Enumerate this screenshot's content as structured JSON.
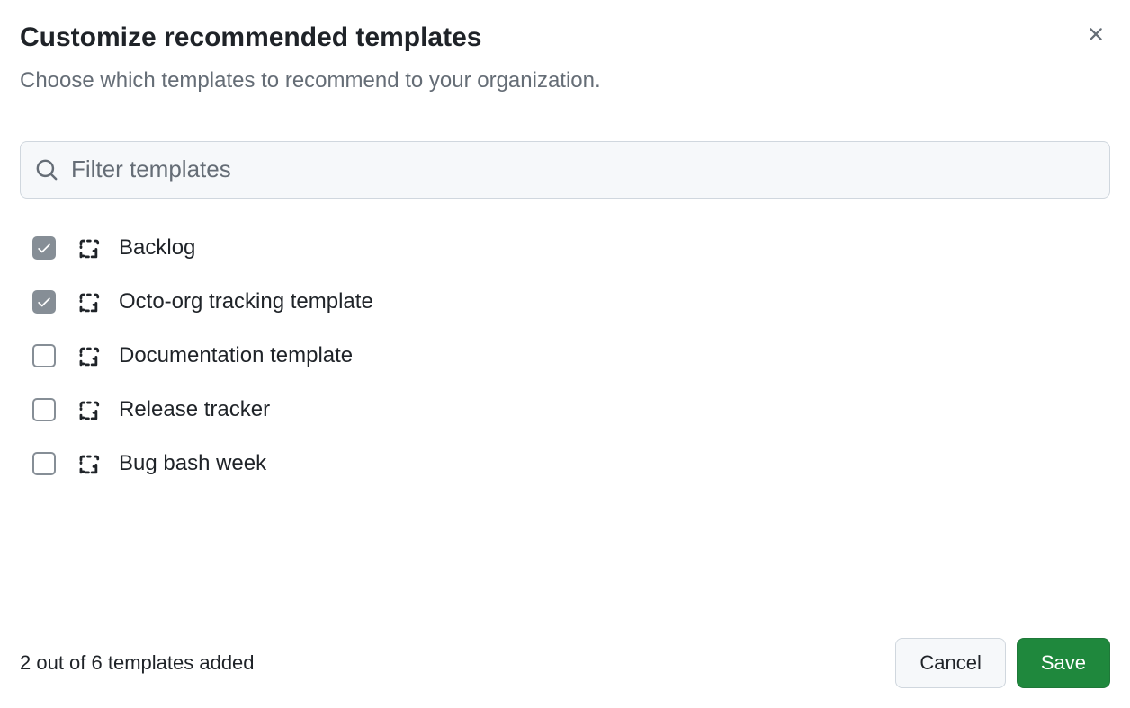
{
  "header": {
    "title": "Customize recommended templates",
    "subtitle": "Choose which templates to recommend to your organization."
  },
  "search": {
    "placeholder": "Filter templates",
    "value": ""
  },
  "templates": [
    {
      "label": "Backlog",
      "checked": true
    },
    {
      "label": "Octo-org tracking template",
      "checked": true
    },
    {
      "label": "Documentation template",
      "checked": false
    },
    {
      "label": "Release tracker",
      "checked": false
    },
    {
      "label": "Bug bash week",
      "checked": false
    }
  ],
  "footer": {
    "status": "2 out of 6 templates added",
    "cancel_label": "Cancel",
    "save_label": "Save"
  }
}
